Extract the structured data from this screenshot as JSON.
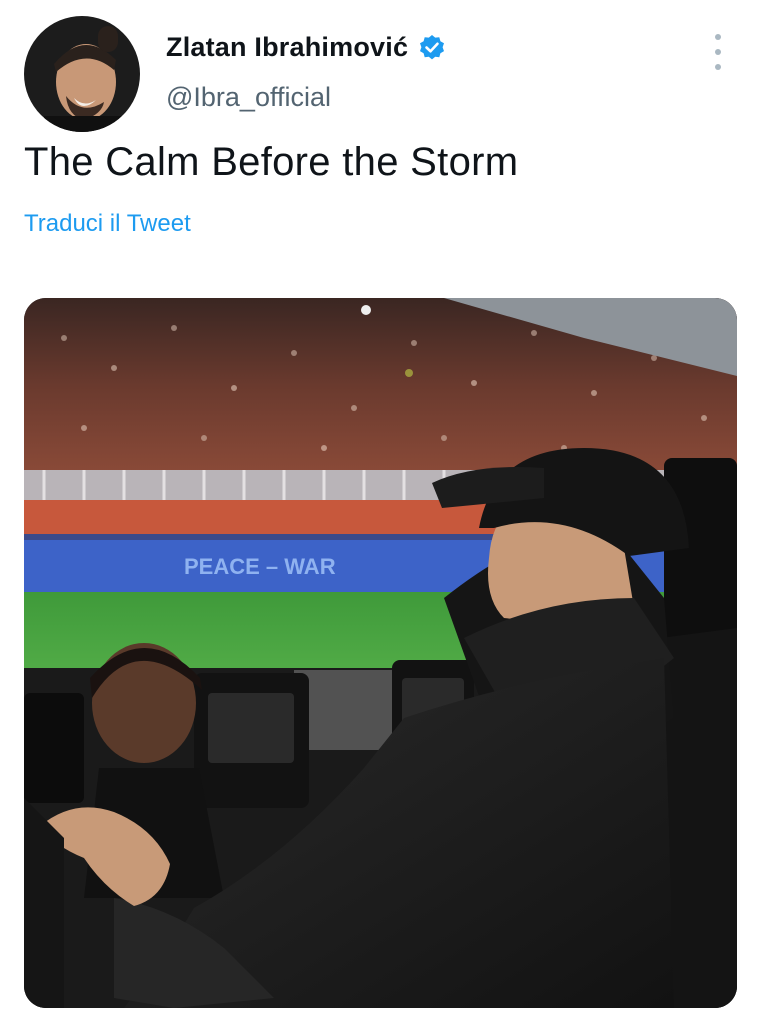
{
  "author": {
    "display_name": "Zlatan Ibrahimović",
    "handle": "@Ibra_official",
    "verified_icon": "verified-badge-icon",
    "avatar_icon": "profile-photo"
  },
  "tweet": {
    "text": "The Calm Before the Storm",
    "translate_label": "Traduci il Tweet"
  },
  "media": {
    "type": "photo",
    "banner_texts": [
      "PEACE – WAR"
    ]
  },
  "menu": {
    "icon": "more-vertical-icon"
  },
  "colors": {
    "link": "#1d9bf0",
    "verified": "#1d9bf0",
    "handle": "#536471",
    "text": "#0f1419"
  }
}
